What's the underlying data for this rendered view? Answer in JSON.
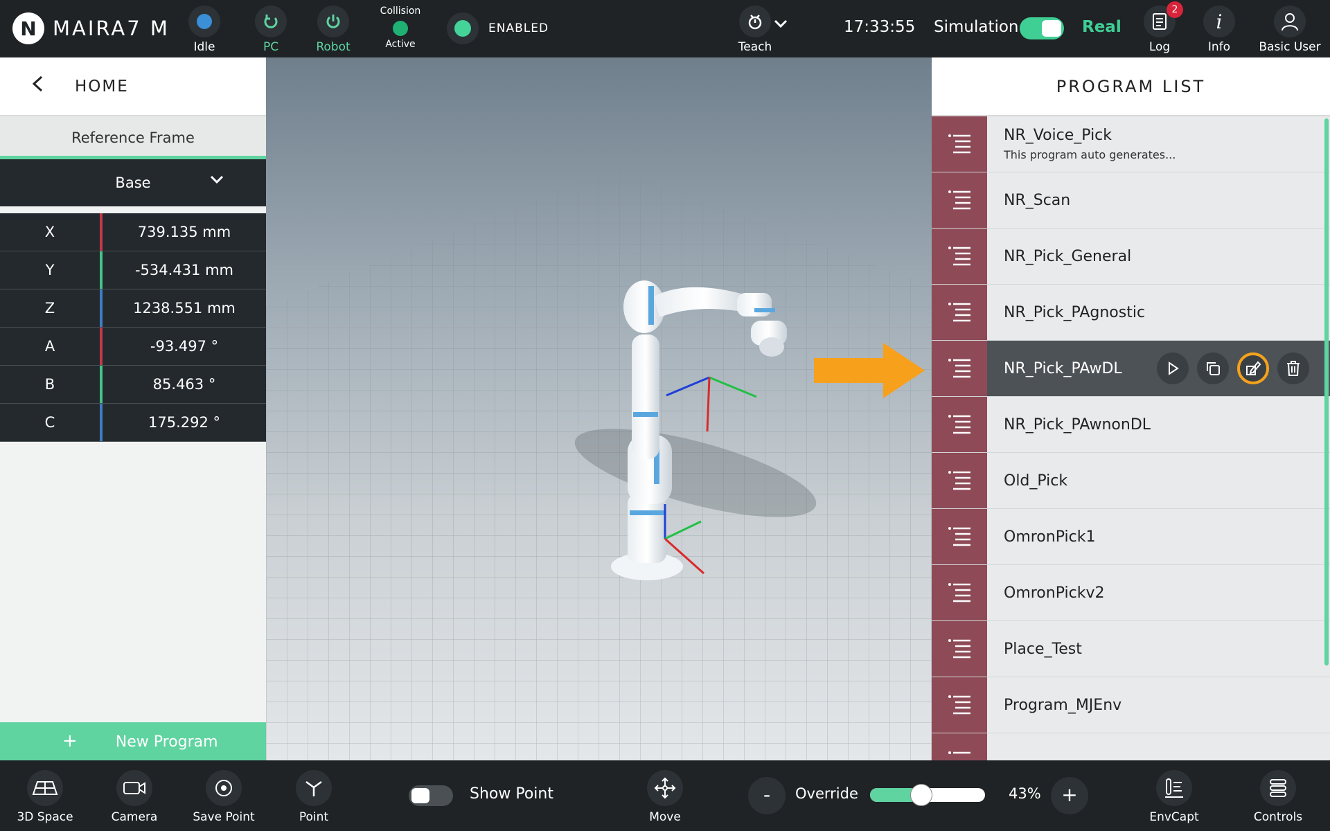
{
  "app": {
    "logo_letter": "N",
    "title": "MAIRA7 M"
  },
  "topbar": {
    "status_idle": "Idle",
    "pc": "PC",
    "robot": "Robot",
    "collision_title": "Collision",
    "collision_state": "Active",
    "enabled": "ENABLED",
    "teach": "Teach",
    "time": "17:33:55",
    "simulation": "Simulation",
    "real": "Real",
    "log": "Log",
    "log_count": "2",
    "info": "Info",
    "user": "Basic User"
  },
  "left": {
    "home": "HOME",
    "reference_frame_label": "Reference Frame",
    "reference_frame_value": "Base",
    "coords": [
      {
        "axis": "X",
        "value": "739.135 mm"
      },
      {
        "axis": "Y",
        "value": "-534.431 mm"
      },
      {
        "axis": "Z",
        "value": "1238.551 mm"
      },
      {
        "axis": "A",
        "value": "-93.497 °"
      },
      {
        "axis": "B",
        "value": "85.463 °"
      },
      {
        "axis": "C",
        "value": "175.292 °"
      }
    ],
    "new_program_plus": "+",
    "new_program": "New Program"
  },
  "program_list": {
    "title": "PROGRAM LIST",
    "items": [
      {
        "name": "NR_Voice_Pick",
        "desc": "This program auto generates..."
      },
      {
        "name": "NR_Scan"
      },
      {
        "name": "NR_Pick_General"
      },
      {
        "name": "NR_Pick_PAgnostic"
      },
      {
        "name": "NR_Pick_PAwDL"
      },
      {
        "name": "NR_Pick_PAwnonDL"
      },
      {
        "name": "Old_Pick"
      },
      {
        "name": "OmronPick1"
      },
      {
        "name": "OmronPickv2"
      },
      {
        "name": "Place_Test"
      },
      {
        "name": "Program_MJEnv"
      }
    ],
    "selected_index": 4
  },
  "bottombar": {
    "space": "3D Space",
    "camera": "Camera",
    "save_point": "Save Point",
    "point": "Point",
    "show_point": "Show Point",
    "move": "Move",
    "override_minus": "-",
    "override": "Override",
    "override_value": 43,
    "override_pct": "43%",
    "override_plus": "+",
    "envcapt": "EnvCapt",
    "controls": "Controls"
  },
  "colors": {
    "accent": "#5fd3a0",
    "program_icon": "#8e4b57",
    "highlight": "#f5a21c",
    "arrow": "#f7a01c"
  }
}
